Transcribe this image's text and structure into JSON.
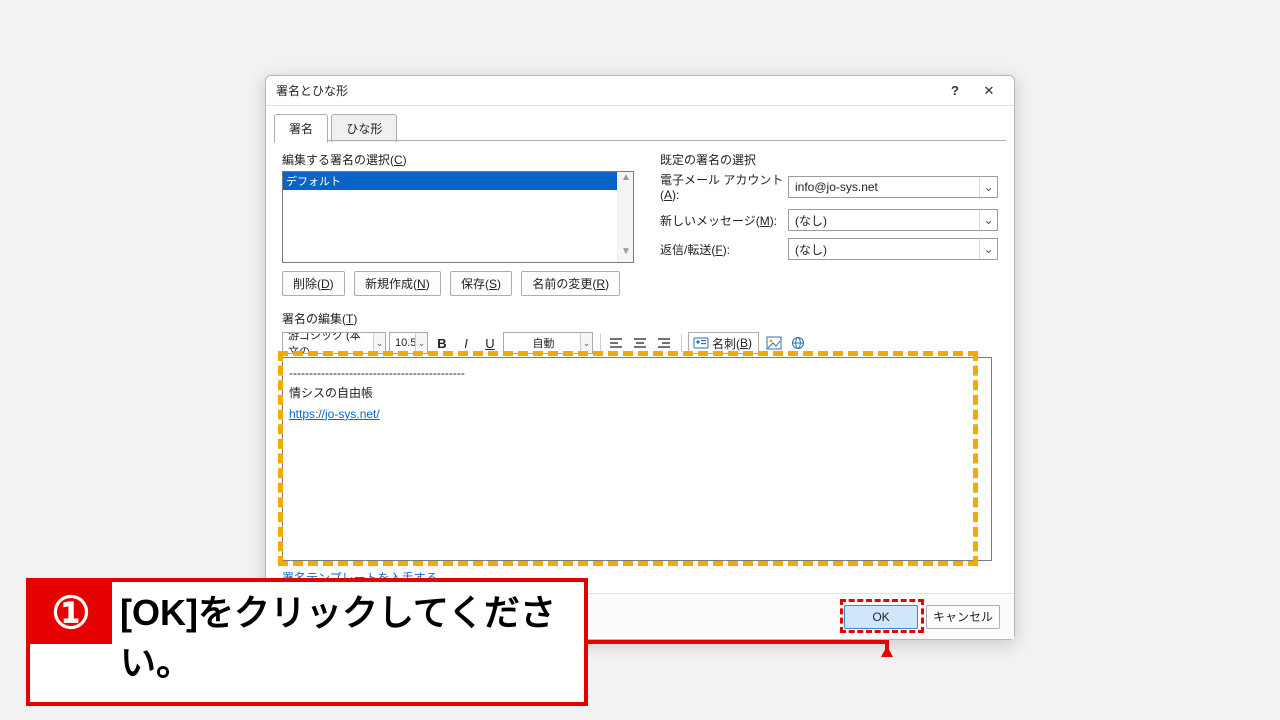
{
  "window": {
    "title": "署名とひな形",
    "help": "?",
    "close": "✕"
  },
  "tabs": {
    "active": "署名",
    "inactive": "ひな形"
  },
  "leftGroup": {
    "label_pre": "編集する署名の選択(",
    "label_u": "C",
    "label_post": ")",
    "items": [
      "デフォルト"
    ],
    "selectedIndex": 0,
    "buttons": {
      "delete_pre": "削除(",
      "delete_u": "D",
      "delete_post": ")",
      "new_pre": "新規作成(",
      "new_u": "N",
      "new_post": ")",
      "save_pre": "保存(",
      "save_u": "S",
      "save_post": ")",
      "rename_pre": "名前の変更(",
      "rename_u": "R",
      "rename_post": ")"
    }
  },
  "rightGroup": {
    "label": "既定の署名の選択",
    "account_pre": "電子メール アカウント(",
    "account_u": "A",
    "account_post": "):",
    "account_val": "info@jo-sys.net",
    "newmsg_pre": "新しいメッセージ(",
    "newmsg_u": "M",
    "newmsg_post": "):",
    "newmsg_val": "(なし)",
    "reply_pre": "返信/転送(",
    "reply_u": "F",
    "reply_post": "):",
    "reply_val": "(なし)"
  },
  "editSec": {
    "label_pre": "署名の編集(",
    "label_u": "T",
    "label_post": ")",
    "font": "游ゴシック (本文の",
    "size": "10.5",
    "color": "自動",
    "bcard_pre": "名刺(",
    "bcard_u": "B",
    "bcard_post": ")",
    "body_line1": "--------------------------------------------",
    "body_line2": "情シスの自由帳",
    "body_url": "https://jo-sys.net/",
    "template_link": "署名テンプレートを入手する"
  },
  "footer": {
    "ok": "OK",
    "cancel": "キャンセル"
  },
  "annotation": {
    "num": "①",
    "text": "[OK]をクリックしてください。"
  }
}
